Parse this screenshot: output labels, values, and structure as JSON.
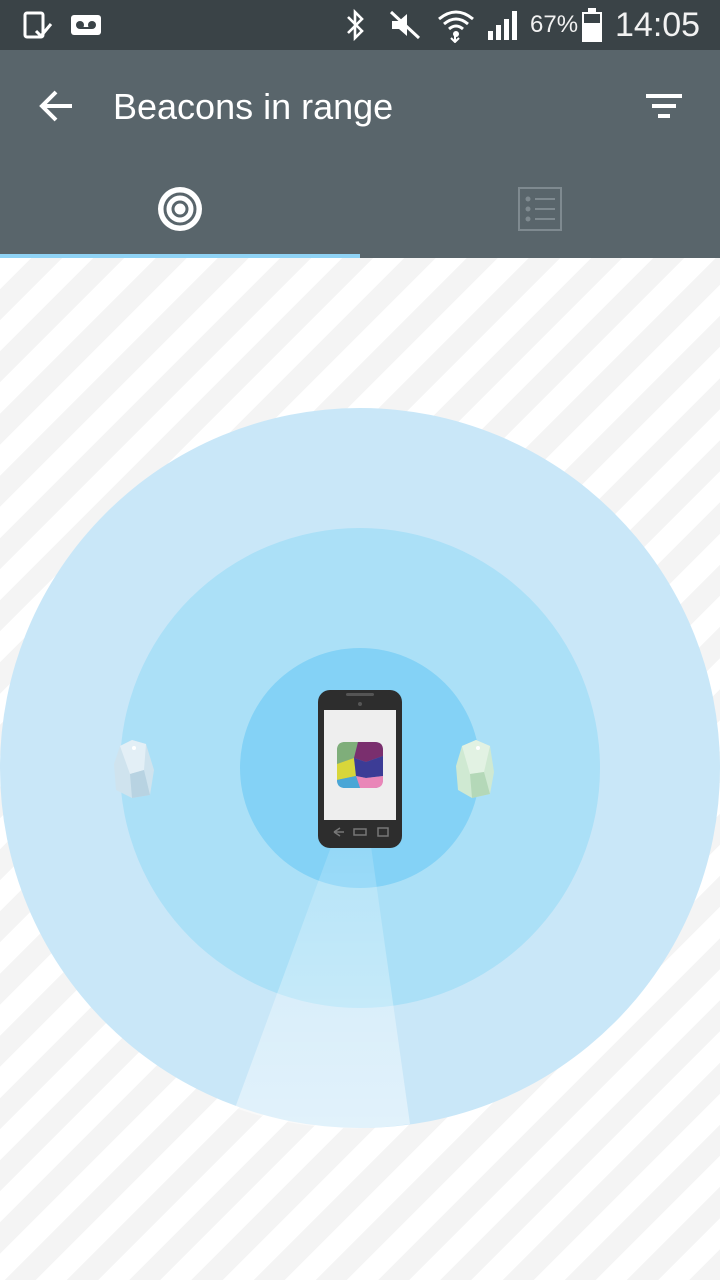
{
  "status_bar": {
    "battery_percent": "67%",
    "time": "14:05",
    "icons": [
      "screenshot-check-icon",
      "voicemail-icon",
      "bluetooth-icon",
      "mute-icon",
      "wifi-icon",
      "signal-icon",
      "battery-icon"
    ]
  },
  "app_bar": {
    "title": "Beacons in range",
    "back_icon": "arrow-back-icon",
    "filter_icon": "filter-icon"
  },
  "tabs": [
    {
      "name": "radar-view",
      "icon": "radar-target-icon",
      "selected": true
    },
    {
      "name": "list-view",
      "icon": "list-icon",
      "selected": false
    }
  ],
  "radar": {
    "center_device": "phone-icon",
    "beacons": [
      {
        "name": "beacon-blue",
        "color": "#cfe3ee"
      },
      {
        "name": "beacon-green",
        "color": "#cfe9d2"
      }
    ]
  },
  "colors": {
    "status_bar": "#3a4347",
    "app_bar": "#59656b",
    "tab_indicator": "#8fd3f5",
    "ring_outer": "#c9e7f8",
    "ring_middle": "#abe0f7",
    "ring_inner": "#84d2f6"
  }
}
